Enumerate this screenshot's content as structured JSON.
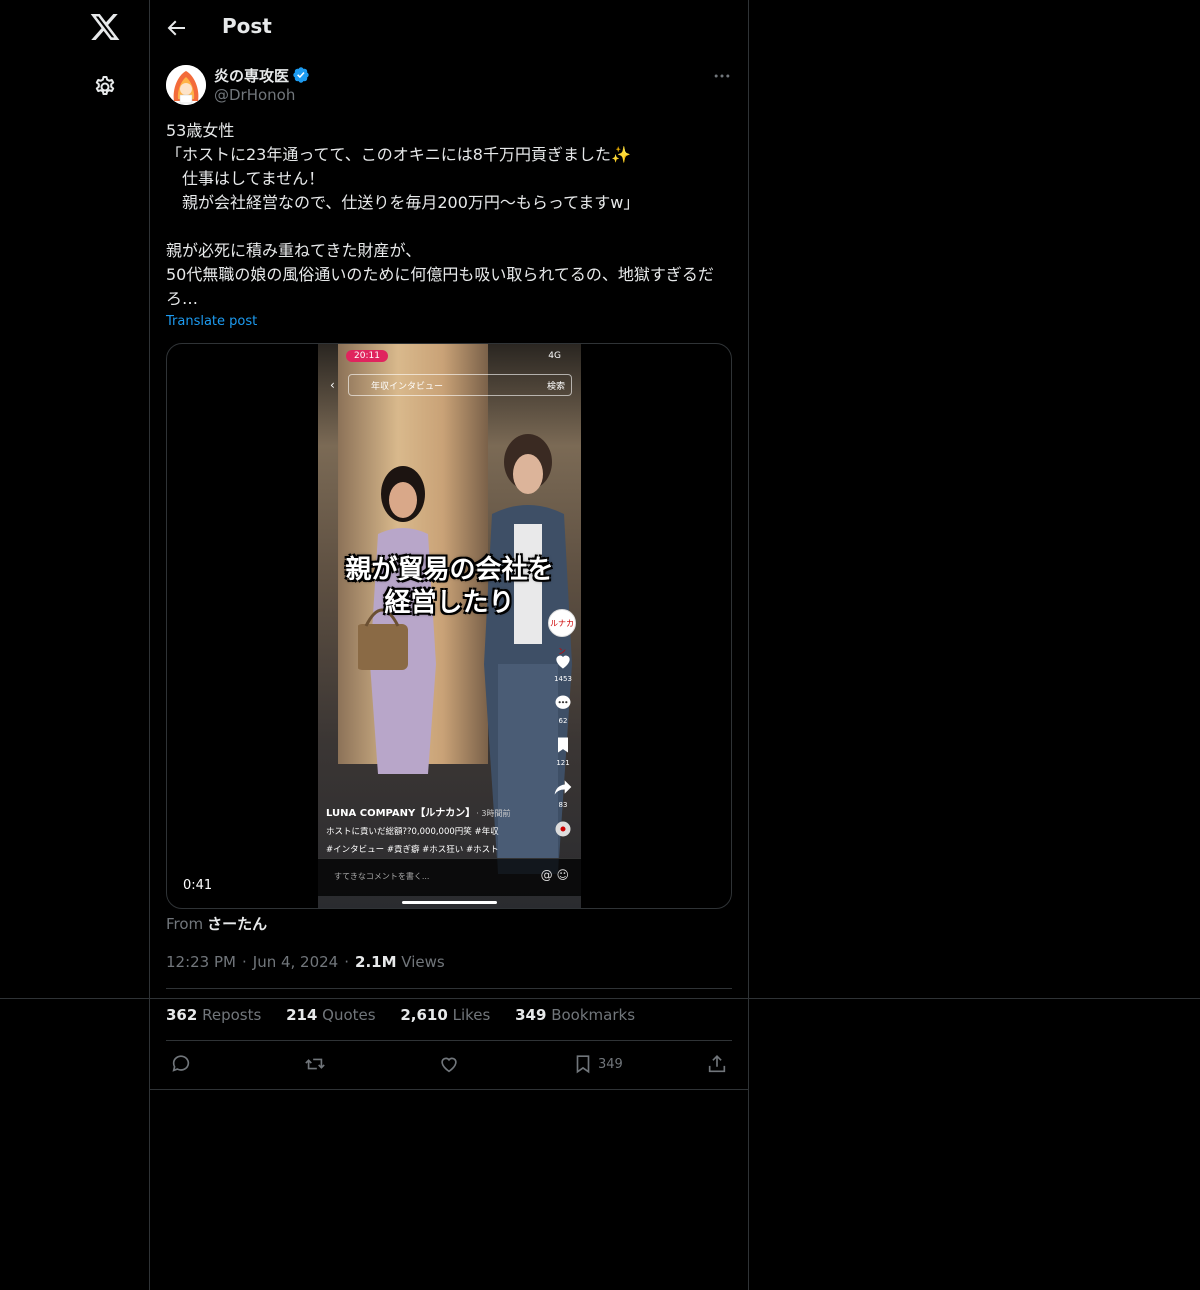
{
  "nav": {
    "logo_icon": "x-logo-icon",
    "settings_icon": "gear-icon"
  },
  "header": {
    "title": "Post",
    "back_icon": "arrow-left-icon"
  },
  "author": {
    "name": "炎の専攻医",
    "handle": "@DrHonoh",
    "verified": true
  },
  "post": {
    "text": "53歳女性\n「ホストに23年通ってて、このオキニには8千万円貢ぎました✨\n　仕事はしてません！\n　親が会社経営なので、仕送りを毎月200万円〜もらってますw」\n\n親が必死に積み重ねてきた財産が、\n50代無職の娘の風俗通いのために何億円も吸い取られてるの、地獄すぎるだろ…",
    "translate_label": "Translate post"
  },
  "video": {
    "duration": "0:41",
    "status_time": "20:11",
    "status_net": "4G",
    "search_text": "年収インタビュー",
    "search_button": "検索",
    "caption_line1": "親が貿易の会社を",
    "caption_line2": "経営したり",
    "side_avatar_text": "ルナカン",
    "likes": "1453",
    "comments": "62",
    "saves": "121",
    "shares": "83",
    "tk_author": "LUNA COMPANY【ルナカン】",
    "tk_time": "· 3時間前",
    "tk_line1": "ホストに貢いだ総額??0,000,000円笑 #年収",
    "tk_line2": "#インタビュー #貢ぎ癖 #ホス狂い #ホスト",
    "comment_placeholder": "すてきなコメントを書く..."
  },
  "source": {
    "from_label": "From",
    "from_name": "さーたん"
  },
  "meta": {
    "time": "12:23 PM",
    "date": "Jun 4, 2024",
    "views_count": "2.1M",
    "views_label": "Views"
  },
  "stats": {
    "reposts_count": "362",
    "reposts_label": "Reposts",
    "quotes_count": "214",
    "quotes_label": "Quotes",
    "likes_count": "2,610",
    "likes_label": "Likes",
    "bookmarks_count": "349",
    "bookmarks_label": "Bookmarks"
  },
  "actions": {
    "bookmark_count": "349"
  },
  "colors": {
    "background": "#000000",
    "text": "#e7e9ea",
    "muted": "#71767b",
    "border": "#2f3336",
    "accent": "#1d9bf0"
  }
}
